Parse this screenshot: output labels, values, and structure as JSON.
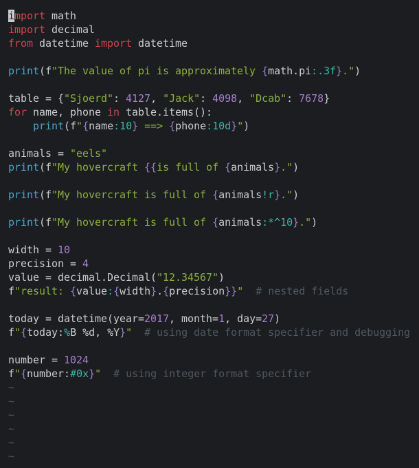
{
  "editor": {
    "mode": "normal",
    "cursor": {
      "line": 1,
      "column": 1
    },
    "colors": {
      "background": "#1b1d20",
      "keyword": "#d0454f",
      "function": "#4fa3c9",
      "string": "#8db041",
      "number": "#a87fd0",
      "brace": "#9a7fc6",
      "format_spec": "#3cb6a8",
      "comment": "#4f5961",
      "text": "#c9cdd2",
      "tilde": "#4d5a5c"
    },
    "lines": [
      [
        [
          "cursor",
          "i"
        ],
        [
          "kw",
          "mport"
        ],
        [
          "plain",
          " math"
        ]
      ],
      [
        [
          "kw",
          "import"
        ],
        [
          "plain",
          " decimal"
        ]
      ],
      [
        [
          "kw",
          "from"
        ],
        [
          "plain",
          " datetime "
        ],
        [
          "kw",
          "import"
        ],
        [
          "plain",
          " datetime"
        ]
      ],
      [],
      [
        [
          "fn",
          "print"
        ],
        [
          "plain",
          "(f"
        ],
        [
          "str",
          "\"The value of pi is approximately "
        ],
        [
          "br",
          "{"
        ],
        [
          "plain",
          "math.pi"
        ],
        [
          "spec",
          ":.3f"
        ],
        [
          "br",
          "}"
        ],
        [
          "str",
          ".\""
        ],
        [
          "plain",
          ")"
        ]
      ],
      [],
      [
        [
          "plain",
          "table = {"
        ],
        [
          "str",
          "\"Sjoerd\""
        ],
        [
          "plain",
          ": "
        ],
        [
          "num",
          "4127"
        ],
        [
          "plain",
          ", "
        ],
        [
          "str",
          "\"Jack\""
        ],
        [
          "plain",
          ": "
        ],
        [
          "num",
          "4098"
        ],
        [
          "plain",
          ", "
        ],
        [
          "str",
          "\"Dcab\""
        ],
        [
          "plain",
          ": "
        ],
        [
          "num",
          "7678"
        ],
        [
          "plain",
          "}"
        ]
      ],
      [
        [
          "kw",
          "for"
        ],
        [
          "plain",
          " name, phone "
        ],
        [
          "kw",
          "in"
        ],
        [
          "plain",
          " table.items():"
        ]
      ],
      [
        [
          "plain",
          "    "
        ],
        [
          "fn",
          "print"
        ],
        [
          "plain",
          "(f"
        ],
        [
          "str",
          "\""
        ],
        [
          "br",
          "{"
        ],
        [
          "plain",
          "name"
        ],
        [
          "spec",
          ":10"
        ],
        [
          "br",
          "}"
        ],
        [
          "str",
          " ==> "
        ],
        [
          "br",
          "{"
        ],
        [
          "plain",
          "phone"
        ],
        [
          "spec",
          ":10d"
        ],
        [
          "br",
          "}"
        ],
        [
          "str",
          "\""
        ],
        [
          "plain",
          ")"
        ]
      ],
      [],
      [
        [
          "plain",
          "animals = "
        ],
        [
          "str",
          "\"eels\""
        ]
      ],
      [
        [
          "fn",
          "print"
        ],
        [
          "plain",
          "(f"
        ],
        [
          "str",
          "\"My hovercraft "
        ],
        [
          "br",
          "{{"
        ],
        [
          "str",
          "is full of "
        ],
        [
          "br",
          "{"
        ],
        [
          "plain",
          "animals"
        ],
        [
          "br",
          "}"
        ],
        [
          "str",
          ".\""
        ],
        [
          "plain",
          ")"
        ]
      ],
      [],
      [
        [
          "fn",
          "print"
        ],
        [
          "plain",
          "(f"
        ],
        [
          "str",
          "\"My hovercraft is full of "
        ],
        [
          "br",
          "{"
        ],
        [
          "plain",
          "animals"
        ],
        [
          "spec",
          "!r"
        ],
        [
          "br",
          "}"
        ],
        [
          "str",
          ".\""
        ],
        [
          "plain",
          ")"
        ]
      ],
      [],
      [
        [
          "fn",
          "print"
        ],
        [
          "plain",
          "(f"
        ],
        [
          "str",
          "\"My hovercraft is full of "
        ],
        [
          "br",
          "{"
        ],
        [
          "plain",
          "animals"
        ],
        [
          "spec",
          ":*^10"
        ],
        [
          "br",
          "}"
        ],
        [
          "str",
          ".\""
        ],
        [
          "plain",
          ")"
        ]
      ],
      [],
      [
        [
          "plain",
          "width = "
        ],
        [
          "num",
          "10"
        ]
      ],
      [
        [
          "plain",
          "precision = "
        ],
        [
          "num",
          "4"
        ]
      ],
      [
        [
          "plain",
          "value = decimal.Decimal("
        ],
        [
          "str",
          "\"12.34567\""
        ],
        [
          "plain",
          ")"
        ]
      ],
      [
        [
          "plain",
          "f"
        ],
        [
          "str",
          "\"result: "
        ],
        [
          "br",
          "{"
        ],
        [
          "plain",
          "value"
        ],
        [
          "spec",
          ":"
        ],
        [
          "br",
          "{"
        ],
        [
          "plain",
          "width"
        ],
        [
          "br",
          "}"
        ],
        [
          "plain",
          "."
        ],
        [
          "br",
          "{"
        ],
        [
          "plain",
          "precision"
        ],
        [
          "br",
          "}}"
        ],
        [
          "str",
          "\""
        ],
        [
          "plain",
          "  "
        ],
        [
          "cmt",
          "# nested fields"
        ]
      ],
      [],
      [
        [
          "plain",
          "today = datetime(year="
        ],
        [
          "num",
          "2017"
        ],
        [
          "plain",
          ", month="
        ],
        [
          "num",
          "1"
        ],
        [
          "plain",
          ", day="
        ],
        [
          "num",
          "27"
        ],
        [
          "plain",
          ")"
        ]
      ],
      [
        [
          "plain",
          "f"
        ],
        [
          "str",
          "\""
        ],
        [
          "br",
          "{"
        ],
        [
          "plain",
          "today:"
        ],
        [
          "spec",
          "%"
        ],
        [
          "plain",
          "B %d, %Y"
        ],
        [
          "br",
          "}"
        ],
        [
          "str",
          "\""
        ],
        [
          "plain",
          "  "
        ],
        [
          "cmt",
          "# using date format specifier and debugging"
        ]
      ],
      [],
      [
        [
          "plain",
          "number = "
        ],
        [
          "num",
          "1024"
        ]
      ],
      [
        [
          "plain",
          "f"
        ],
        [
          "str",
          "\""
        ],
        [
          "br",
          "{"
        ],
        [
          "plain",
          "number:"
        ],
        [
          "spec",
          "#0x"
        ],
        [
          "br",
          "}"
        ],
        [
          "str",
          "\""
        ],
        [
          "plain",
          "  "
        ],
        [
          "cmt",
          "# using integer format specifier"
        ]
      ]
    ],
    "empty_line_marker": "~",
    "empty_line_count": 6
  }
}
